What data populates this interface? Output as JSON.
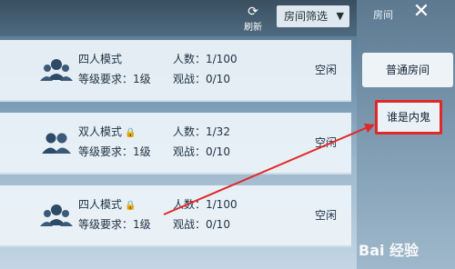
{
  "header": {
    "refresh_label": "刷新",
    "filter_label": "房间筛选",
    "side_title": "房间"
  },
  "rooms": [
    {
      "mode": "四人模式",
      "locked": false,
      "level": "等级要求：1级",
      "players": "人数：1/100",
      "spectators": "观战：0/10",
      "status": "空闲"
    },
    {
      "mode": "双人模式",
      "locked": true,
      "level": "等级要求：1级",
      "players": "人数：1/32",
      "spectators": "观战：0/10",
      "status": "空闲"
    },
    {
      "mode": "四人模式",
      "locked": true,
      "level": "等级要求：1级",
      "players": "人数：1/100",
      "spectators": "观战：0/10",
      "status": "空闲"
    }
  ],
  "side_tabs": [
    {
      "label": "普通房间"
    },
    {
      "label": "谁是内鬼"
    }
  ],
  "watermark": "Bai 经验",
  "colors": {
    "highlight": "#e02828",
    "panel": "#eef3f8"
  }
}
